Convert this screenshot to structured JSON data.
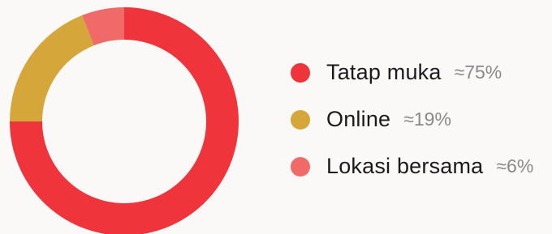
{
  "chart_data": {
    "type": "pie",
    "variant": "donut",
    "start": "top",
    "direction": "clockwise",
    "legend_position": "right",
    "slices": [
      {
        "label": "Tatap muka",
        "value": 75,
        "value_label": "≈75%",
        "color": "#ef353b"
      },
      {
        "label": "Online",
        "value": 19,
        "value_label": "≈19%",
        "color": "#d5a63a"
      },
      {
        "label": "Lokasi bersama",
        "value": 6,
        "value_label": "≈6%",
        "color": "#f06a6a"
      }
    ]
  }
}
